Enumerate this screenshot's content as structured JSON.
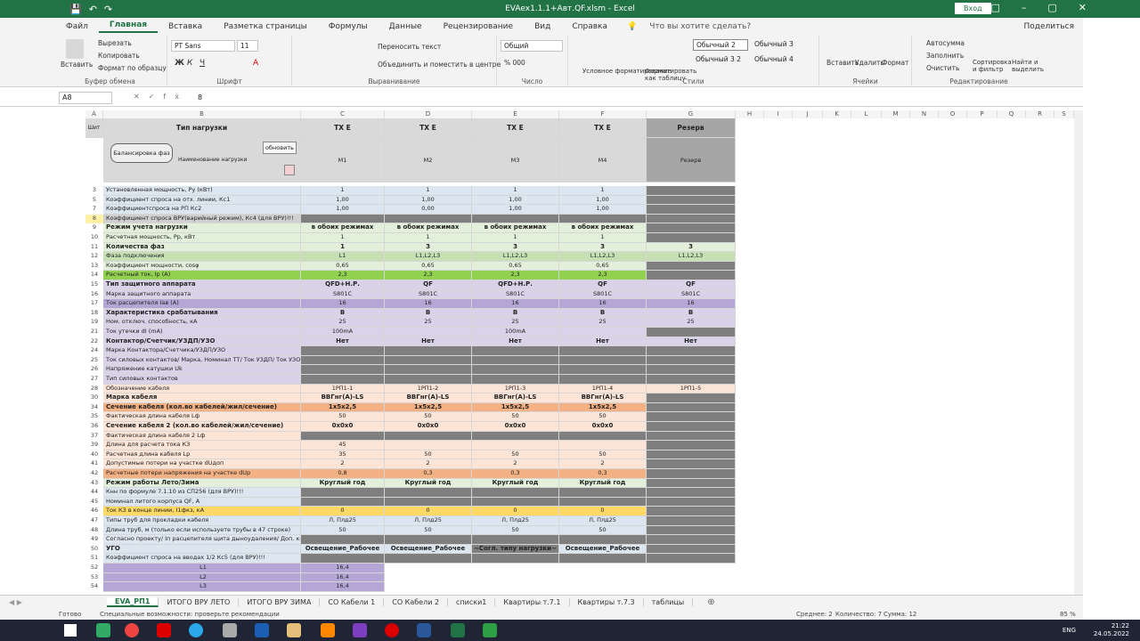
{
  "window": {
    "title": "EVAex1.1.1+Авт.QF.xlsm - Excel",
    "signin": "Вход"
  },
  "menu": {
    "tabs": [
      "Файл",
      "Главная",
      "Вставка",
      "Разметка страницы",
      "Формулы",
      "Данные",
      "Рецензирование",
      "Вид",
      "Справка"
    ],
    "tellme": "Что вы хотите сделать?",
    "share": "Поделиться"
  },
  "ribbon": {
    "clipboard": {
      "paste": "Вставить",
      "cut": "Вырезать",
      "copy": "Копировать",
      "format_painter": "Формат по образцу",
      "label": "Буфер обмена"
    },
    "font": {
      "name": "PT Sans",
      "size": "11",
      "label": "Шрифт"
    },
    "alignment": {
      "wrap": "Переносить текст",
      "merge": "Объединить и поместить в центре",
      "label": "Выравнивание"
    },
    "number": {
      "format": "Общий",
      "label": "Число"
    },
    "styles": {
      "conditional": "Условное форматирование",
      "as_table": "Форматировать как таблицу",
      "s1": "Обычный 2",
      "s2": "Обычный 3",
      "s3": "Обычный 3 2",
      "s4": "Обычный 4",
      "label": "Стили"
    },
    "cells": {
      "insert": "Вставить",
      "delete": "Удалить",
      "format": "Формат",
      "label": "Ячейки"
    },
    "editing": {
      "autosum": "Автосумма",
      "fill": "Заполнить",
      "clear": "Очистить",
      "sort": "Сортировка и фильтр",
      "find": "Найти и выделить",
      "label": "Редактирование"
    }
  },
  "formula": {
    "namebox": "A8",
    "fx": "fx",
    "value": "8"
  },
  "columns": [
    "A",
    "B",
    "C",
    "D",
    "E",
    "F",
    "G",
    "H",
    "I",
    "J",
    "K",
    "L",
    "M",
    "N",
    "O",
    "P",
    "Q",
    "R",
    "S"
  ],
  "header": {
    "A": "Шит",
    "B": "Тип нагрузки",
    "C": "ТХ Е",
    "D": "ТХ Е",
    "E": "ТХ Е",
    "F": "ТХ Е",
    "G": "Резерв",
    "balance_btn": "Балансировка фаз",
    "name_label": "Наименование нагрузки",
    "update_btn": "обновить",
    "names": [
      "М1",
      "М2",
      "М3",
      "М4",
      "Резерв"
    ]
  },
  "rows": [
    {
      "n": "3",
      "label": "Установленная мощность, Ру (кВт)",
      "v": [
        "1",
        "1",
        "1",
        "1",
        ""
      ],
      "bg": "#dce6f1"
    },
    {
      "n": "5",
      "label": "Коэффициент спроса на отх. линии, Кс1",
      "v": [
        "1,00",
        "1,00",
        "1,00",
        "1,00",
        ""
      ],
      "bg": "#dce6f1"
    },
    {
      "n": "7",
      "label": "Коэффициентспроса на РП Кс2",
      "v": [
        "1,00",
        "0,00",
        "1,00",
        "1,00",
        ""
      ],
      "bg": "#dce6f1"
    },
    {
      "n": "8",
      "label": "Коэффициент спроса ВРУ(варийный режим), Кс4 (для ВРУ)!!!",
      "v": [
        "",
        "",
        "",
        "",
        ""
      ],
      "bg": "#d0d0d0"
    },
    {
      "n": "9",
      "label": "Режим учета нагрузки",
      "v": [
        "в обоих режимах",
        "в обоих режимах",
        "в обоих режимах",
        "в обоих режимах",
        ""
      ],
      "bg": "#e2efda",
      "bold": true
    },
    {
      "n": "10",
      "label": "Расчетная мощность, Рр, кВт",
      "v": [
        "1",
        "1",
        "1",
        "1",
        ""
      ],
      "bg": "#e2efda"
    },
    {
      "n": "11",
      "label": "Количества фаз",
      "v": [
        "1",
        "3",
        "3",
        "3",
        "3"
      ],
      "bg": "#e2efda",
      "bold": true
    },
    {
      "n": "12",
      "label": "Фаза подключения",
      "v": [
        "L1",
        "L1,L2,L3",
        "L1,L2,L3",
        "L1,L2,L3",
        "L1,L2,L3"
      ],
      "bg": "#c6e0b4"
    },
    {
      "n": "13",
      "label": "Коэффициент мощности, cosφ",
      "v": [
        "0,65",
        "0,65",
        "0,65",
        "0,65",
        ""
      ],
      "bg": "#e2efda"
    },
    {
      "n": "14",
      "label": "Расчетный ток, Iр (А)",
      "v": [
        "2,3",
        "2,3",
        "2,3",
        "2,3",
        ""
      ],
      "bg": "#92d050"
    },
    {
      "n": "15",
      "label": "Тип защитного аппарата",
      "v": [
        "QFD+Н.Р.",
        "QF",
        "QFD+Н.Р.",
        "QF",
        "QF"
      ],
      "bg": "#d9d2e9",
      "bold": true
    },
    {
      "n": "16",
      "label": "Марка защитного аппарата",
      "v": [
        "S801C",
        "S801C",
        "S801C",
        "S801C",
        "S801C"
      ],
      "bg": "#d9d2e9"
    },
    {
      "n": "17",
      "label": "Ток расцепителя Iав (А)",
      "v": [
        "16",
        "16",
        "16",
        "16",
        "16"
      ],
      "bg": "#b4a7d6"
    },
    {
      "n": "18",
      "label": "Характеристика срабатывания",
      "v": [
        "B",
        "B",
        "B",
        "B",
        "B"
      ],
      "bg": "#d9d2e9",
      "bold": true
    },
    {
      "n": "19",
      "label": "Ном. отключ. способность, кА",
      "v": [
        "25",
        "25",
        "25",
        "25",
        "25"
      ],
      "bg": "#d9d2e9"
    },
    {
      "n": "21",
      "label": "Ток утечки dI (mA)",
      "v": [
        "100mA",
        "",
        "100mA",
        "",
        ""
      ],
      "bg": "#d9d2e9"
    },
    {
      "n": "22",
      "label": "Контактор/Счетчик/УЗДП/УЗО",
      "v": [
        "Нет",
        "Нет",
        "Нет",
        "Нет",
        "Нет"
      ],
      "bg": "#d9d2e9",
      "bold": true
    },
    {
      "n": "24",
      "label": "Марка Контактора/Счетчика/УЗДП/УЗО",
      "v": [
        "",
        "",
        "",
        "",
        ""
      ],
      "bg": "#d9d2e9"
    },
    {
      "n": "25",
      "label": "Ток силовых контактов/ Марка, Номинал ТТ/ Ток УЗДП/ Ток УЗО",
      "v": [
        "",
        "",
        "",
        "",
        ""
      ],
      "bg": "#d9d2e9"
    },
    {
      "n": "26",
      "label": "Напряжение катушки Uk",
      "v": [
        "",
        "",
        "",
        "",
        ""
      ],
      "bg": "#d9d2e9"
    },
    {
      "n": "27",
      "label": "Тип силовых контактов",
      "v": [
        "",
        "",
        "",
        "",
        ""
      ],
      "bg": "#d9d2e9"
    },
    {
      "n": "28",
      "label": "Обозначение кабеля",
      "v": [
        "1РП1-1",
        "1РП1-2",
        "1РП1-3",
        "1РП1-4",
        "1РП1-5"
      ],
      "bg": "#fce4d6"
    },
    {
      "n": "30",
      "label": "Марка кабеля",
      "v": [
        "ВВГнг(А)-LS",
        "ВВГнг(А)-LS",
        "ВВГнг(А)-LS",
        "ВВГнг(А)-LS",
        ""
      ],
      "bg": "#fce4d6",
      "bold": true
    },
    {
      "n": "34",
      "label": "Сечение кабеля (кол.во кабелей/жил/сечение)",
      "v": [
        "1х5х2,5",
        "1х5х2,5",
        "1х5х2,5",
        "1х5х2,5",
        ""
      ],
      "bg": "#f4b183",
      "bold": true
    },
    {
      "n": "35",
      "label": "Фактическая длина кабеля Lф",
      "v": [
        "50",
        "50",
        "50",
        "50",
        ""
      ],
      "bg": "#fce4d6"
    },
    {
      "n": "36",
      "label": "Сечение кабеля 2 (кол.во кабелей/жил/сечение)",
      "v": [
        "0х0х0",
        "0х0х0",
        "0х0х0",
        "0х0х0",
        ""
      ],
      "bg": "#fce4d6",
      "bold": true
    },
    {
      "n": "37",
      "label": "Фактическая длина кабеля 2 Lф",
      "v": [
        "",
        "",
        "",
        "",
        ""
      ],
      "bg": "#fce4d6"
    },
    {
      "n": "39",
      "label": "Длина для расчета тока КЗ",
      "v": [
        "45",
        "",
        "",
        "",
        ""
      ],
      "bg": "#fce4d6"
    },
    {
      "n": "40",
      "label": "Расчетная длина кабеля Lр",
      "v": [
        "35",
        "50",
        "50",
        "50",
        ""
      ],
      "bg": "#fce4d6"
    },
    {
      "n": "41",
      "label": "Допустимые потери на участке dUдоп",
      "v": [
        "2",
        "2",
        "2",
        "2",
        ""
      ],
      "bg": "#fce4d6"
    },
    {
      "n": "42",
      "label": "Расчетные потери напряжения на участке dUр",
      "v": [
        "0,8",
        "0,3",
        "0,3",
        "0,3",
        ""
      ],
      "bg": "#f4b183"
    },
    {
      "n": "43",
      "label": "Режим работы Лето/Зима",
      "v": [
        "Круглый год",
        "Круглый год",
        "Круглый год",
        "Круглый год",
        ""
      ],
      "bg": "#e2efda",
      "bold": true
    },
    {
      "n": "44",
      "label": "Кнн по формуле 7.1.10 из СП256 (для ВРУ)!!!",
      "v": [
        "",
        "",
        "",
        "",
        ""
      ],
      "bg": "#dce6f1"
    },
    {
      "n": "45",
      "label": "Номинал литого корпуса QF, А",
      "v": [
        "",
        "",
        "",
        "",
        ""
      ],
      "bg": "#dce6f1"
    },
    {
      "n": "46",
      "label": "Ток КЗ в конце линии, I1фкз, кА",
      "v": [
        "0",
        "0",
        "0",
        "0",
        ""
      ],
      "bg": "#ffd966"
    },
    {
      "n": "47",
      "label": "Типы труб для прокладки кабеля",
      "v": [
        "Л, Плд25",
        "Л, Плд25",
        "Л, Плд25",
        "Л, Плд25",
        ""
      ],
      "bg": "#dce6f1"
    },
    {
      "n": "48",
      "label": "Длина труб, м (только если используете трубы в 47 строке)",
      "v": [
        "50",
        "50",
        "50",
        "50",
        ""
      ],
      "bg": "#dce6f1"
    },
    {
      "n": "49",
      "label": "Согласно проекту/ Iп расцепителя щита дыноудаления/ Доп. комментарии",
      "v": [
        "",
        "",
        "",
        "",
        ""
      ],
      "bg": "#dce6f1"
    },
    {
      "n": "50",
      "label": "УГО",
      "v": [
        "Освещение_Рабочее",
        "Освещение_Рабочее",
        "~Согл. типу нагрузки~",
        "Освещение_Рабочее",
        ""
      ],
      "bg": "#dce6f1",
      "bold": true
    },
    {
      "n": "51",
      "label": "Коэффициент спроса на вводах 1/2 Кс5 (для ВРУ)!!!",
      "v": [
        "",
        "",
        "",
        "",
        ""
      ],
      "bg": "#dce6f1"
    },
    {
      "n": "52",
      "label": "L1",
      "v": [
        "16,4",
        "",
        "",
        "",
        ""
      ],
      "bg": "#b4a7d6"
    },
    {
      "n": "53",
      "label": "L2",
      "v": [
        "16,4",
        "",
        "",
        "",
        ""
      ],
      "bg": "#b4a7d6"
    },
    {
      "n": "54",
      "label": "L3",
      "v": [
        "16,4",
        "",
        "",
        "",
        ""
      ],
      "bg": "#b4a7d6"
    }
  ],
  "sheets": [
    "EVA_РП1",
    "ИТОГО ВРУ ЛЕТО",
    "ИТОГО ВРУ ЗИМА",
    "СО Кабели 1",
    "СО Кабели 2",
    "списки1",
    "Квартиры т.7.1",
    "Квартиры т.7.3",
    "таблицы"
  ],
  "status": {
    "ready": "Готово",
    "accessibility": "Специальные возможности: проверьте рекомендации",
    "avg": "Среднее: 2",
    "count": "Количество: 7",
    "sum": "Сумма: 12",
    "zoom": "85 %"
  },
  "taskbar": {
    "lang": "ENG",
    "time": "21:22",
    "date": "24.05.2022"
  }
}
